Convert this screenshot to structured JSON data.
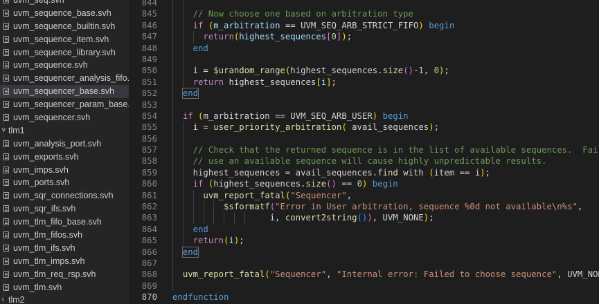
{
  "explorer": {
    "rows": [
      {
        "type": "file",
        "name": "uvm_seq.svh"
      },
      {
        "type": "file",
        "name": "uvm_sequence_base.svh"
      },
      {
        "type": "file",
        "name": "uvm_sequence_builtin.svh"
      },
      {
        "type": "file",
        "name": "uvm_sequence_item.svh"
      },
      {
        "type": "file",
        "name": "uvm_sequence_library.svh"
      },
      {
        "type": "file",
        "name": "uvm_sequence.svh"
      },
      {
        "type": "file",
        "name": "uvm_sequencer_analysis_fifo.svh"
      },
      {
        "type": "file",
        "name": "uvm_sequencer_base.svh",
        "selected": true
      },
      {
        "type": "file",
        "name": "uvm_sequencer_param_base.svh"
      },
      {
        "type": "file",
        "name": "uvm_sequencer.svh"
      },
      {
        "type": "folder",
        "name": "tlm1",
        "expanded": true
      },
      {
        "type": "file",
        "name": "uvm_analysis_port.svh"
      },
      {
        "type": "file",
        "name": "uvm_exports.svh"
      },
      {
        "type": "file",
        "name": "uvm_imps.svh"
      },
      {
        "type": "file",
        "name": "uvm_ports.svh"
      },
      {
        "type": "file",
        "name": "uvm_sqr_connections.svh"
      },
      {
        "type": "file",
        "name": "uvm_sqr_ifs.svh"
      },
      {
        "type": "file",
        "name": "uvm_tlm_fifo_base.svh"
      },
      {
        "type": "file",
        "name": "uvm_tlm_fifos.svh"
      },
      {
        "type": "file",
        "name": "uvm_tlm_ifs.svh"
      },
      {
        "type": "file",
        "name": "uvm_tlm_imps.svh"
      },
      {
        "type": "file",
        "name": "uvm_tlm_req_rsp.svh"
      },
      {
        "type": "file",
        "name": "uvm_tlm.svh"
      },
      {
        "type": "folder",
        "name": "tlm2",
        "expanded": false
      }
    ]
  },
  "editor": {
    "active_line": "870",
    "lines": [
      {
        "n": "844",
        "indent": 0,
        "guides": [
          1,
          2
        ],
        "tokens": []
      },
      {
        "n": "845",
        "indent": 0,
        "guides": [
          1,
          2
        ],
        "tokens": [
          [
            "    // Now choose one based on arbitration type",
            "cm"
          ]
        ]
      },
      {
        "n": "846",
        "indent": 0,
        "guides": [
          1,
          2
        ],
        "tokens": [
          [
            "    ",
            ""
          ],
          [
            "if",
            "ctl"
          ],
          [
            " ",
            ""
          ],
          [
            "(",
            "br1"
          ],
          [
            "m_arbitration",
            "var"
          ],
          [
            " == UVM_SEQ_ARB_STRICT_FIFO",
            ""
          ],
          [
            ")",
            "br1"
          ],
          [
            " ",
            ""
          ],
          [
            "begin",
            "kw"
          ]
        ]
      },
      {
        "n": "847",
        "indent": 0,
        "guides": [
          1,
          2,
          3
        ],
        "tokens": [
          [
            "      ",
            ""
          ],
          [
            "return",
            "ctl"
          ],
          [
            "(",
            "br1"
          ],
          [
            "highest_sequences",
            "var"
          ],
          [
            "[",
            "br2"
          ],
          [
            "0",
            "num"
          ],
          [
            "]",
            "br2"
          ],
          [
            ")",
            "br1"
          ],
          [
            ";",
            ""
          ]
        ]
      },
      {
        "n": "848",
        "indent": 0,
        "guides": [
          1,
          2
        ],
        "tokens": [
          [
            "    ",
            ""
          ],
          [
            "end",
            "kw"
          ]
        ]
      },
      {
        "n": "849",
        "indent": 0,
        "guides": [
          1,
          2
        ],
        "tokens": []
      },
      {
        "n": "850",
        "indent": 0,
        "guides": [
          1,
          2
        ],
        "tokens": [
          [
            "    i = ",
            ""
          ],
          [
            "$urandom_range",
            "fn"
          ],
          [
            "(",
            "br1"
          ],
          [
            "highest_sequences.",
            ""
          ],
          [
            "size",
            "fn"
          ],
          [
            "(",
            "br2"
          ],
          [
            ")",
            "br2"
          ],
          [
            "-",
            ""
          ],
          [
            "1",
            "num"
          ],
          [
            ", ",
            ""
          ],
          [
            "0",
            "num"
          ],
          [
            ")",
            "br1"
          ],
          [
            ";",
            ""
          ]
        ]
      },
      {
        "n": "851",
        "indent": 0,
        "guides": [
          1,
          2
        ],
        "tokens": [
          [
            "    ",
            ""
          ],
          [
            "return",
            "ctl"
          ],
          [
            " highest_sequences",
            ""
          ],
          [
            "[",
            "br1"
          ],
          [
            "i",
            "var"
          ],
          [
            "]",
            "br1"
          ],
          [
            ";",
            ""
          ]
        ]
      },
      {
        "n": "852",
        "indent": 0,
        "guides": [
          1
        ],
        "tokens": [
          [
            "  ",
            ""
          ],
          [
            "end",
            "kw box"
          ]
        ]
      },
      {
        "n": "853",
        "indent": 0,
        "guides": [
          1
        ],
        "tokens": []
      },
      {
        "n": "854",
        "indent": 0,
        "guides": [
          1
        ],
        "tokens": [
          [
            "  ",
            ""
          ],
          [
            "if",
            "ctl"
          ],
          [
            " ",
            ""
          ],
          [
            "(",
            "br1"
          ],
          [
            "m_arbitration == UVM_SEQ_ARB_USER",
            ""
          ],
          [
            ")",
            "br1"
          ],
          [
            " ",
            ""
          ],
          [
            "begin",
            "kw"
          ]
        ]
      },
      {
        "n": "855",
        "indent": 0,
        "guides": [
          1,
          2
        ],
        "tokens": [
          [
            "    i = ",
            ""
          ],
          [
            "user_priority_arbitration",
            "fn"
          ],
          [
            "(",
            "br1"
          ],
          [
            " avail_sequences",
            ""
          ],
          [
            ")",
            "br1"
          ],
          [
            ";",
            ""
          ]
        ]
      },
      {
        "n": "856",
        "indent": 0,
        "guides": [
          1,
          2
        ],
        "tokens": []
      },
      {
        "n": "857",
        "indent": 0,
        "guides": [
          1,
          2
        ],
        "tokens": [
          [
            "    // Check that the returned sequence is in the list of available sequences.  Failure to",
            "cm"
          ]
        ]
      },
      {
        "n": "858",
        "indent": 0,
        "guides": [
          1,
          2
        ],
        "tokens": [
          [
            "    // use an available sequence will cause highly unpredictable results.",
            "cm"
          ]
        ]
      },
      {
        "n": "859",
        "indent": 0,
        "guides": [
          1,
          2
        ],
        "tokens": [
          [
            "    highest_sequences = avail_sequences.",
            ""
          ],
          [
            "find",
            "fn"
          ],
          [
            " with ",
            ""
          ],
          [
            "(",
            "br1"
          ],
          [
            "item == i",
            ""
          ],
          [
            ")",
            "br1"
          ],
          [
            ";",
            ""
          ]
        ]
      },
      {
        "n": "860",
        "indent": 0,
        "guides": [
          1,
          2
        ],
        "tokens": [
          [
            "    ",
            ""
          ],
          [
            "if",
            "ctl"
          ],
          [
            " ",
            ""
          ],
          [
            "(",
            "br1"
          ],
          [
            "highest_sequences.",
            ""
          ],
          [
            "size",
            "fn"
          ],
          [
            "(",
            "br2"
          ],
          [
            ")",
            "br2"
          ],
          [
            " == ",
            ""
          ],
          [
            "0",
            "num"
          ],
          [
            ")",
            "br1"
          ],
          [
            " ",
            ""
          ],
          [
            "begin",
            "kw"
          ]
        ]
      },
      {
        "n": "861",
        "indent": 0,
        "guides": [
          1,
          2,
          3
        ],
        "tokens": [
          [
            "      ",
            ""
          ],
          [
            "uvm_report_fatal",
            "fn"
          ],
          [
            "(",
            "br1"
          ],
          [
            "\"Sequencer\"",
            "str"
          ],
          [
            ",",
            ""
          ]
        ]
      },
      {
        "n": "862",
        "indent": 0,
        "guides": [
          1,
          2,
          3,
          4,
          5
        ],
        "tokens": [
          [
            "          ",
            ""
          ],
          [
            "$sformatf",
            "fn"
          ],
          [
            "(",
            "br2"
          ],
          [
            "\"Error in User arbitration, sequence %0d not available\\n%s\"",
            "str"
          ],
          [
            ",",
            ""
          ]
        ]
      },
      {
        "n": "863",
        "indent": 0,
        "guides": [
          1,
          2,
          3,
          4,
          5,
          6,
          7,
          8
        ],
        "tokens": [
          [
            "                   i, ",
            ""
          ],
          [
            "convert2string",
            "fn"
          ],
          [
            "(",
            "br3"
          ],
          [
            ")",
            "br3"
          ],
          [
            ")",
            "br2"
          ],
          [
            ", UVM_NONE",
            ""
          ],
          [
            ")",
            "br1"
          ],
          [
            ";",
            ""
          ]
        ]
      },
      {
        "n": "864",
        "indent": 0,
        "guides": [
          1,
          2
        ],
        "tokens": [
          [
            "    ",
            ""
          ],
          [
            "end",
            "kw"
          ]
        ]
      },
      {
        "n": "865",
        "indent": 0,
        "guides": [
          1,
          2
        ],
        "tokens": [
          [
            "    ",
            ""
          ],
          [
            "return",
            "ctl"
          ],
          [
            "(",
            "br1"
          ],
          [
            "i",
            "var"
          ],
          [
            ")",
            "br1"
          ],
          [
            ";",
            ""
          ]
        ]
      },
      {
        "n": "866",
        "indent": 0,
        "guides": [
          1
        ],
        "tokens": [
          [
            "  ",
            ""
          ],
          [
            "end",
            "kw box"
          ]
        ]
      },
      {
        "n": "867",
        "indent": 0,
        "guides": [
          1
        ],
        "tokens": []
      },
      {
        "n": "868",
        "indent": 0,
        "guides": [
          1
        ],
        "tokens": [
          [
            "  ",
            ""
          ],
          [
            "uvm_report_fatal",
            "fn"
          ],
          [
            "(",
            "br1"
          ],
          [
            "\"Sequencer\"",
            "str"
          ],
          [
            ", ",
            ""
          ],
          [
            "\"Internal error: Failed to choose sequence\"",
            "str"
          ],
          [
            ", UVM_NONE",
            ""
          ],
          [
            ")",
            "br1"
          ],
          [
            ";",
            ""
          ]
        ]
      },
      {
        "n": "869",
        "indent": 0,
        "guides": [
          1
        ],
        "tokens": []
      },
      {
        "n": "870",
        "indent": 0,
        "guides": [],
        "tokens": [
          [
            "endfunction",
            "kw"
          ]
        ]
      }
    ]
  }
}
